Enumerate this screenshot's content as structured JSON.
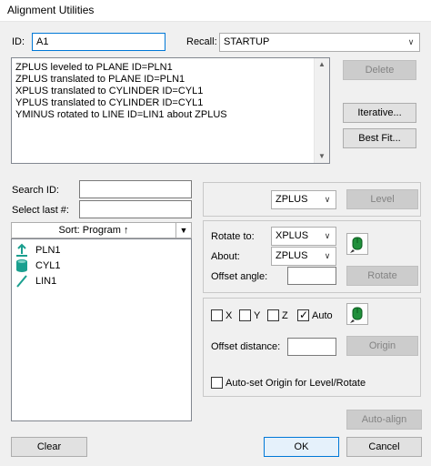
{
  "window": {
    "title": "Alignment Utilities"
  },
  "id_field": {
    "label": "ID:",
    "value": "A1"
  },
  "recall": {
    "label": "Recall:",
    "value": "STARTUP"
  },
  "log": {
    "lines": [
      "ZPLUS leveled to PLANE ID=PLN1",
      "ZPLUS translated to PLANE ID=PLN1",
      "XPLUS translated to CYLINDER ID=CYL1",
      "YPLUS translated to CYLINDER ID=CYL1",
      "YMINUS rotated to LINE ID=LIN1 about ZPLUS"
    ]
  },
  "buttons": {
    "delete": "Delete",
    "iterative": "Iterative...",
    "best_fit": "Best Fit...",
    "level": "Level",
    "rotate": "Rotate",
    "origin": "Origin",
    "auto_align": "Auto-align",
    "clear": "Clear",
    "ok": "OK",
    "cancel": "Cancel"
  },
  "search": {
    "search_id_label": "Search ID:",
    "select_last_label": "Select last #:",
    "search_id_value": "",
    "select_last_value": ""
  },
  "sort": {
    "label": "Sort: Program ↑",
    "dropdown_glyph": "▼"
  },
  "features": [
    {
      "name": "PLN1",
      "icon": "plane-icon",
      "color": "#1a9f8f"
    },
    {
      "name": "CYL1",
      "icon": "cylinder-icon",
      "color": "#1a9f8f"
    },
    {
      "name": "LIN1",
      "icon": "line-icon",
      "color": "#1a9f8f"
    }
  ],
  "level_axis": {
    "value": "ZPLUS"
  },
  "rotate": {
    "rotate_to_label": "Rotate to:",
    "rotate_to_value": "XPLUS",
    "about_label": "About:",
    "about_value": "ZPLUS",
    "offset_angle_label": "Offset angle:",
    "offset_angle_value": ""
  },
  "origin": {
    "x_label": "X",
    "y_label": "Y",
    "z_label": "Z",
    "auto_label": "Auto",
    "x_checked": false,
    "y_checked": false,
    "z_checked": false,
    "auto_checked": true,
    "offset_distance_label": "Offset distance:",
    "offset_distance_value": ""
  },
  "auto_set": {
    "label": "Auto-set Origin for Level/Rotate",
    "checked": false
  },
  "dropdown_glyph": "∨",
  "checkmark_glyph": "✓",
  "colors": {
    "accent": "#0078d7",
    "disabled_text": "#838383",
    "icon_green": "#1f8f3a"
  }
}
